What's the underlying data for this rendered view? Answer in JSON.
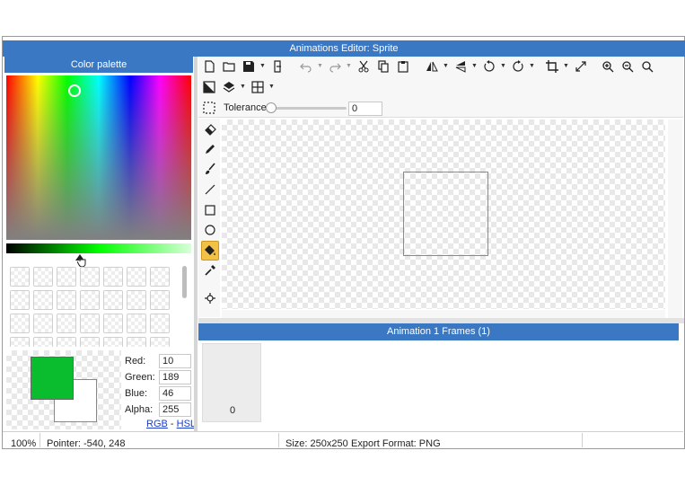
{
  "window_title": "Animations Editor: Sprite",
  "palette": {
    "title": "Color palette",
    "labels": {
      "red": "Red:",
      "green": "Green:",
      "blue": "Blue:",
      "alpha": "Alpha:"
    },
    "values": {
      "red": "10",
      "green": "189",
      "blue": "46",
      "alpha": "255"
    },
    "mode_rgb": "RGB",
    "mode_sep": "-",
    "mode_hsl": "HSL",
    "current_color": "#0abd2e"
  },
  "toolbar": {
    "tolerance_label": "Tolerance",
    "tolerance_value": "0",
    "icons": [
      "new-file-icon",
      "open-folder-icon",
      "save-icon",
      "export-icon",
      "undo-icon",
      "redo-icon",
      "cut-icon",
      "copy-icon",
      "paste-icon",
      "flip-horizontal-icon",
      "flip-vertical-icon",
      "rotate-ccw-icon",
      "rotate-cw-icon",
      "crop-icon",
      "resize-icon",
      "zoom-in-icon",
      "zoom-out-icon",
      "zoom-fit-icon",
      "transparent-toggle-icon",
      "layers-icon",
      "grid-icon",
      "select-icon"
    ]
  },
  "tools": [
    "eraser",
    "pencil",
    "brush",
    "line",
    "rectangle",
    "ellipse",
    "paint-bucket",
    "eyedropper",
    "pin"
  ],
  "frames": {
    "title": "Animation 1 Frames (1)",
    "items": [
      {
        "label": "0"
      }
    ]
  },
  "statusbar": {
    "zoom": "100%",
    "pointer": "Pointer: -540, 248",
    "size": "Size: 250x250",
    "format": "Export Format: PNG"
  },
  "colors": {
    "accent": "#3a78c3",
    "selected_tool": "#f3c146"
  }
}
